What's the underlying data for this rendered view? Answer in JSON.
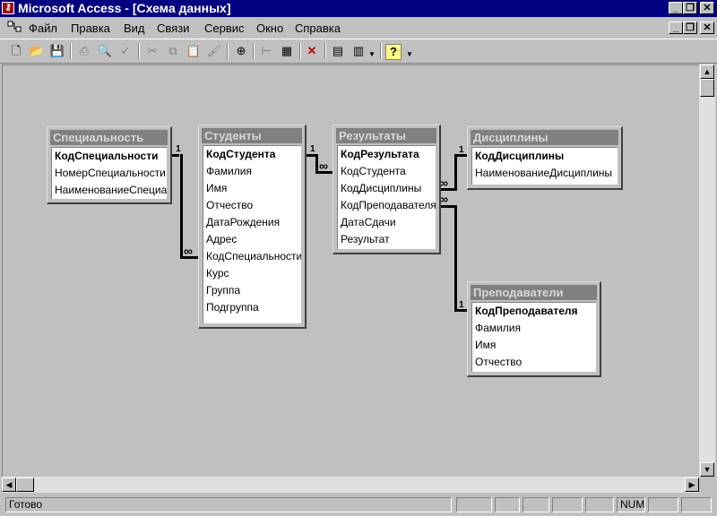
{
  "app": {
    "title": "Microsoft Access - [Схема данных]",
    "icon": "access-key-icon"
  },
  "caption_buttons": [
    "_",
    "❐",
    "✕"
  ],
  "menu": [
    {
      "label": "Файл"
    },
    {
      "label": "Правка"
    },
    {
      "label": "Вид"
    },
    {
      "label": "Связи"
    },
    {
      "label": "Сервис"
    },
    {
      "label": "Окно"
    },
    {
      "label": "Справка"
    }
  ],
  "toolbar": {
    "icons": [
      "relationships-icon",
      "new-icon",
      "open-icon",
      "save-icon",
      "print-icon",
      "print-preview-icon",
      "spelling-icon",
      "cut-icon",
      "copy-icon",
      "paste-icon",
      "format-painter-icon",
      "show-table-icon",
      "show-direct-icon",
      "show-all-icon",
      "delete-icon",
      "new-object-icon",
      "new-object-dropdown-icon",
      "help-icon"
    ],
    "glyphs": {
      "relationships": "⊞",
      "new": "🗋",
      "open": "📂",
      "save": "💾",
      "print": "⎙",
      "preview": "🔍",
      "spell": "✓",
      "cut": "✂",
      "copy": "⧉",
      "paste": "📋",
      "painter": "🖌",
      "show_table": "⊕",
      "show_direct": "⊢",
      "show_all": "▦",
      "delete": "✕",
      "new_object": "▤",
      "new_object2": "▥",
      "help": "?"
    }
  },
  "tables": {
    "specialty": {
      "title": "Специальность",
      "fields": [
        {
          "name": "КодСпециальности",
          "pk": true
        },
        {
          "name": "НомерСпециальности",
          "pk": false
        },
        {
          "name": "НаименованиеСпециальности",
          "pk": false
        }
      ]
    },
    "students": {
      "title": "Студенты",
      "fields": [
        {
          "name": "КодСтудента",
          "pk": true
        },
        {
          "name": "Фамилия",
          "pk": false
        },
        {
          "name": "Имя",
          "pk": false
        },
        {
          "name": "Отчество",
          "pk": false
        },
        {
          "name": "ДатаРождения",
          "pk": false
        },
        {
          "name": "Адрес",
          "pk": false
        },
        {
          "name": "КодСпециальности",
          "pk": false
        },
        {
          "name": "Курс",
          "pk": false
        },
        {
          "name": "Группа",
          "pk": false
        },
        {
          "name": "Подгруппа",
          "pk": false
        }
      ]
    },
    "results": {
      "title": "Результаты",
      "fields": [
        {
          "name": "КодРезультата",
          "pk": true
        },
        {
          "name": "КодСтудента",
          "pk": false
        },
        {
          "name": "КодДисциплины",
          "pk": false
        },
        {
          "name": "КодПреподавателя",
          "pk": false
        },
        {
          "name": "ДатаСдачи",
          "pk": false
        },
        {
          "name": "Результат",
          "pk": false
        }
      ]
    },
    "disciplines": {
      "title": "Дисциплины",
      "fields": [
        {
          "name": "КодДисциплины",
          "pk": true
        },
        {
          "name": "НаименованиеДисциплины",
          "pk": false
        }
      ]
    },
    "teachers": {
      "title": "Преподаватели",
      "fields": [
        {
          "name": "КодПреподавателя",
          "pk": true
        },
        {
          "name": "Фамилия",
          "pk": false
        },
        {
          "name": "Имя",
          "pk": false
        },
        {
          "name": "Отчество",
          "pk": false
        }
      ]
    }
  },
  "relationships": {
    "one": "1",
    "many": "∞"
  },
  "status": {
    "text": "Готово",
    "num": "NUM"
  }
}
